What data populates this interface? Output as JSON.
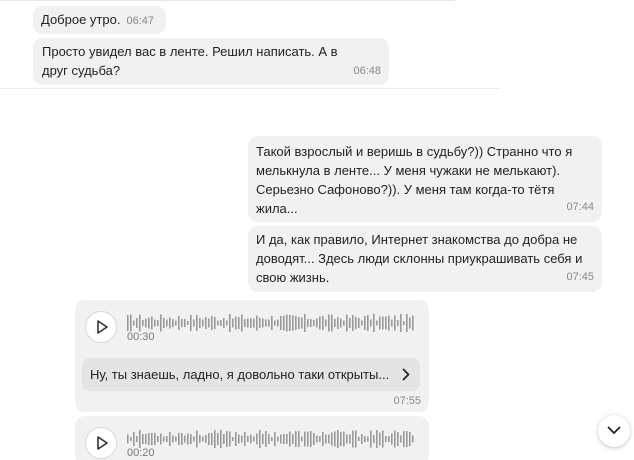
{
  "messages": [
    {
      "text": "Доброе утро.",
      "time": "06:47"
    },
    {
      "text": "Просто увидел вас в ленте. Решил написать. А в друг судьба?",
      "time": "06:48"
    },
    {
      "text": "Такой взрослый и веришь в судьбу?)) Странно что я мелькнула в ленте... У меня чужаки не мелькают). Серьезно Сафоново?)). У меня там когда-то тётя жила...",
      "time": "07:44"
    },
    {
      "text": "И да, как правило, Интернет знакомства до добра не доводят... Здесь люди склонны приукрашивать себя и свою жизнь.",
      "time": "07:45"
    }
  ],
  "voice_messages": [
    {
      "duration": "00:30",
      "transcript": "Ну, ты знаешь, ладно, я довольно таки открыты...",
      "time": "07:55"
    },
    {
      "duration": "00:20"
    }
  ],
  "icons": {
    "play": "play-icon",
    "chevron_right": "chevron-right-icon",
    "scroll_down": "chevron-down-icon"
  },
  "colors": {
    "bubble": "#f1f1f1",
    "transcript_bg": "#e4e4e4",
    "time": "#888888"
  }
}
